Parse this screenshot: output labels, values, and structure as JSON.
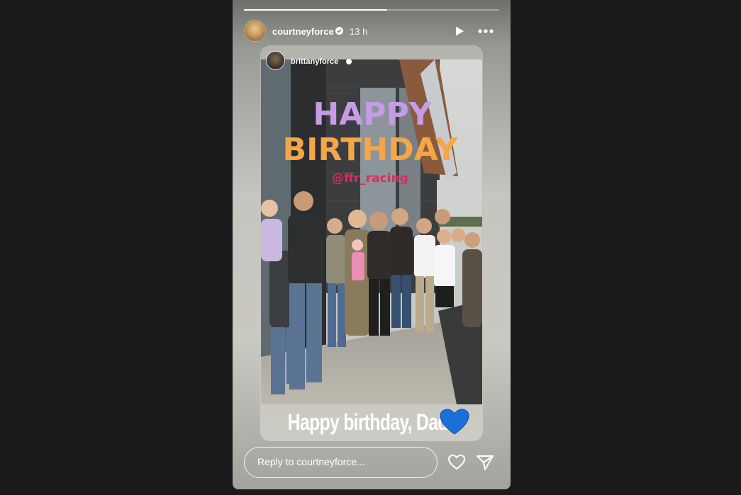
{
  "story": {
    "progress": 0.56,
    "author": {
      "username": "courtneyforce",
      "time": "13 h"
    },
    "reshare": {
      "username": "brittanyforce"
    },
    "photo_overlay": {
      "line1": "HAPPY",
      "line2": "BIRTHDAY",
      "mention": "@ffr_racing"
    },
    "caption": "Happy birthday, Dad!",
    "caption_emoji": "blue-heart"
  },
  "reply": {
    "placeholder": "Reply to courtneyforce..."
  },
  "icons": {
    "play": "play-icon",
    "more": "more-icon",
    "like": "heart-icon",
    "share": "send-icon"
  },
  "colors": {
    "background": "#1a1a1a",
    "text": "#ffffff",
    "heart": "#1a6fd9"
  }
}
